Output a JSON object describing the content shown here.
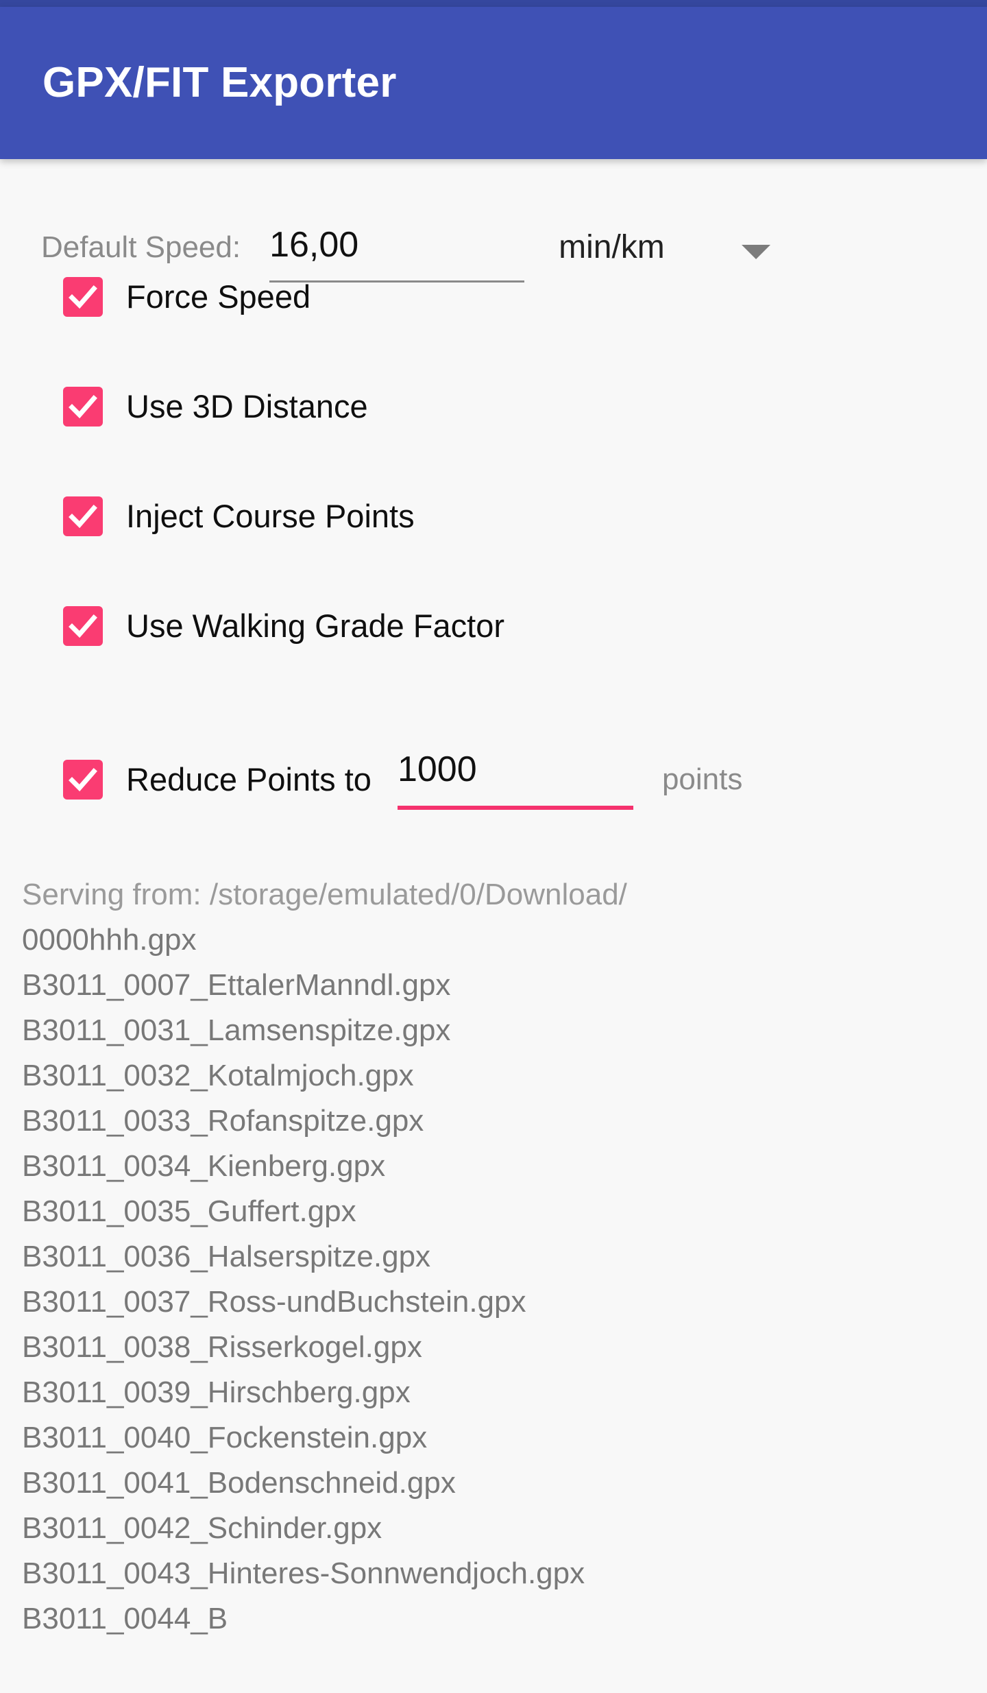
{
  "app": {
    "title": "GPX/FIT Exporter",
    "accent_blue": "#3F51B5",
    "accent_pink": "#FA3C72",
    "background": "#F8F8F8"
  },
  "speed": {
    "label": "Default Speed:",
    "value": "16,00",
    "unit_selected": "min/km",
    "dropdown_icon": "chevron-down-icon"
  },
  "checkboxes": [
    {
      "label": "Force Speed",
      "checked": true
    },
    {
      "label": "Use 3D Distance",
      "checked": true
    },
    {
      "label": "Inject Course Points",
      "checked": true
    },
    {
      "label": "Use Walking Grade Factor",
      "checked": true
    }
  ],
  "reduce_points": {
    "checked": true,
    "label": "Reduce Points to",
    "value": "1000",
    "suffix": "points"
  },
  "file_browser": {
    "serving_from": "Serving from: /storage/emulated/0/Download/",
    "files": [
      "0000hhh.gpx",
      "B3011_0007_EttalerManndl.gpx",
      "B3011_0031_Lamsenspitze.gpx",
      "B3011_0032_Kotalmjoch.gpx",
      "B3011_0033_Rofanspitze.gpx",
      "B3011_0034_Kienberg.gpx",
      "B3011_0035_Guffert.gpx",
      "B3011_0036_Halserspitze.gpx",
      "B3011_0037_Ross-undBuchstein.gpx",
      "B3011_0038_Risserkogel.gpx",
      "B3011_0039_Hirschberg.gpx",
      "B3011_0040_Fockenstein.gpx",
      "B3011_0041_Bodenschneid.gpx",
      "B3011_0042_Schinder.gpx",
      "B3011_0043_Hinteres-Sonnwendjoch.gpx",
      "B3011_0044_B"
    ]
  }
}
